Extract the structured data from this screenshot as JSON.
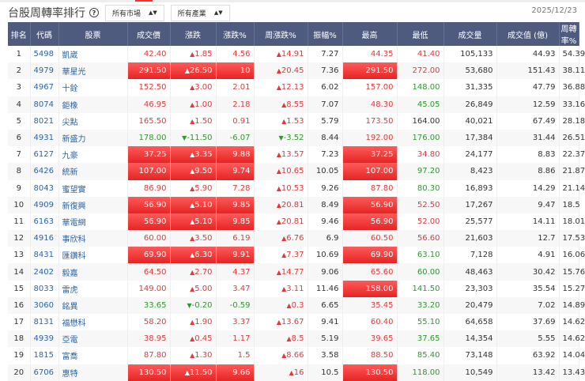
{
  "title": "台股周轉率排行",
  "help_icon": "?",
  "filters": {
    "market": "所有市場",
    "industry": "所有產業"
  },
  "date": "2025/12/23",
  "colors": {
    "up": "#e03a3a",
    "down": "#2a9a2a",
    "header": "#4e5b7e",
    "limit": "#f03030"
  },
  "columns": [
    "排名",
    "代碼",
    "股票",
    "成交價",
    "漲跌",
    "漲跌%",
    "周漲跌%",
    "振幅%",
    "最高",
    "最低",
    "成交量",
    "成交值 (億)",
    "周轉率%"
  ],
  "rows": [
    {
      "rank": "1",
      "code": "5498",
      "name": "凱崴",
      "price": "42.40",
      "chg": "1.85",
      "pct": "4.56",
      "wk": "14.91",
      "amp": "7.27",
      "high": "44.35",
      "low": "41.40",
      "vol": "105,133",
      "val": "44.93",
      "turn": "54.39",
      "limit": []
    },
    {
      "rank": "2",
      "code": "4979",
      "name": "華星光",
      "price": "291.50",
      "chg": "26.50",
      "pct": "10",
      "wk": "20.45",
      "amp": "7.36",
      "high": "291.50",
      "low": "272.00",
      "vol": "53,680",
      "val": "151.43",
      "turn": "38.11",
      "limit": [
        "price",
        "chg",
        "pct",
        "high"
      ]
    },
    {
      "rank": "3",
      "code": "4967",
      "name": "十銓",
      "price": "152.50",
      "chg": "3.00",
      "pct": "2.01",
      "wk": "12.13",
      "amp": "6.02",
      "high": "157.00",
      "low": "148.00",
      "vol": "31,335",
      "val": "47.79",
      "turn": "36.88",
      "limit": []
    },
    {
      "rank": "4",
      "code": "8074",
      "name": "鉅橡",
      "price": "46.95",
      "chg": "1.00",
      "pct": "2.18",
      "wk": "8.55",
      "amp": "7.07",
      "high": "48.30",
      "low": "45.05",
      "vol": "26,849",
      "val": "12.59",
      "turn": "33.16",
      "limit": []
    },
    {
      "rank": "5",
      "code": "8021",
      "name": "尖點",
      "price": "165.50",
      "chg": "1.50",
      "pct": "0.91",
      "wk": "1.53",
      "amp": "5.79",
      "high": "173.50",
      "low": "164.00",
      "vol": "40,021",
      "val": "67.49",
      "turn": "28.18",
      "limit": []
    },
    {
      "rank": "6",
      "code": "4931",
      "name": "新盛力",
      "price": "178.00",
      "chg": "-11.50",
      "pct": "-6.07",
      "wk": "-3.52",
      "amp": "8.44",
      "high": "192.00",
      "low": "176.00",
      "vol": "17,384",
      "val": "31.44",
      "turn": "26.51",
      "limit": []
    },
    {
      "rank": "7",
      "code": "6127",
      "name": "九豪",
      "price": "37.25",
      "chg": "3.35",
      "pct": "9.88",
      "wk": "13.57",
      "amp": "7.23",
      "high": "37.25",
      "low": "34.80",
      "vol": "24,177",
      "val": "8.83",
      "turn": "22.37",
      "limit": [
        "price",
        "chg",
        "pct",
        "high"
      ]
    },
    {
      "rank": "8",
      "code": "6426",
      "name": "統新",
      "price": "107.00",
      "chg": "9.50",
      "pct": "9.74",
      "wk": "10.65",
      "amp": "10.05",
      "high": "107.00",
      "low": "97.20",
      "vol": "8,423",
      "val": "8.86",
      "turn": "21.87",
      "limit": [
        "price",
        "chg",
        "pct",
        "high"
      ]
    },
    {
      "rank": "9",
      "code": "8043",
      "name": "蜜望實",
      "price": "86.90",
      "chg": "5.90",
      "pct": "7.28",
      "wk": "10.53",
      "amp": "9.26",
      "high": "87.80",
      "low": "80.30",
      "vol": "16,893",
      "val": "14.29",
      "turn": "21.14",
      "limit": []
    },
    {
      "rank": "10",
      "code": "4909",
      "name": "新復興",
      "price": "56.90",
      "chg": "5.10",
      "pct": "9.85",
      "wk": "20.81",
      "amp": "8.49",
      "high": "56.90",
      "low": "52.50",
      "vol": "17,267",
      "val": "9.47",
      "turn": "18.5",
      "limit": [
        "price",
        "chg",
        "pct",
        "high"
      ]
    },
    {
      "rank": "11",
      "code": "6163",
      "name": "華電網",
      "price": "56.90",
      "chg": "5.10",
      "pct": "9.85",
      "wk": "20.81",
      "amp": "9.46",
      "high": "56.90",
      "low": "52.00",
      "vol": "25,577",
      "val": "14.11",
      "turn": "18.01",
      "limit": [
        "price",
        "chg",
        "pct",
        "high"
      ]
    },
    {
      "rank": "12",
      "code": "4916",
      "name": "事欣科",
      "price": "60.00",
      "chg": "3.50",
      "pct": "6.19",
      "wk": "6.76",
      "amp": "6.9",
      "high": "60.50",
      "low": "56.60",
      "vol": "21,603",
      "val": "12.7",
      "turn": "17.53",
      "limit": []
    },
    {
      "rank": "13",
      "code": "8431",
      "name": "匯鑽科",
      "price": "69.90",
      "chg": "6.30",
      "pct": "9.91",
      "wk": "7.37",
      "amp": "10.69",
      "high": "69.90",
      "low": "63.10",
      "vol": "7,128",
      "val": "4.91",
      "turn": "16.06",
      "limit": [
        "price",
        "chg",
        "pct",
        "high"
      ]
    },
    {
      "rank": "14",
      "code": "2402",
      "name": "毅嘉",
      "price": "64.50",
      "chg": "2.70",
      "pct": "4.37",
      "wk": "14.77",
      "amp": "9.06",
      "high": "65.60",
      "low": "60.00",
      "vol": "48,463",
      "val": "30.42",
      "turn": "15.76",
      "limit": []
    },
    {
      "rank": "15",
      "code": "8033",
      "name": "雷虎",
      "price": "149.00",
      "chg": "5.00",
      "pct": "3.47",
      "wk": "3.11",
      "amp": "11.46",
      "high": "158.00",
      "low": "141.50",
      "vol": "23,303",
      "val": "35.54",
      "turn": "15.27",
      "limit": [
        "high"
      ]
    },
    {
      "rank": "16",
      "code": "3060",
      "name": "銘異",
      "price": "33.65",
      "chg": "-0.20",
      "pct": "-0.59",
      "wk": "0.3",
      "amp": "6.65",
      "high": "35.45",
      "low": "33.20",
      "vol": "20,479",
      "val": "7.02",
      "turn": "14.89",
      "limit": []
    },
    {
      "rank": "17",
      "code": "8131",
      "name": "福懋科",
      "price": "58.20",
      "chg": "1.90",
      "pct": "3.37",
      "wk": "13.67",
      "amp": "9.41",
      "high": "60.40",
      "low": "55.10",
      "vol": "64,658",
      "val": "37.69",
      "turn": "14.62",
      "limit": []
    },
    {
      "rank": "18",
      "code": "4939",
      "name": "亞電",
      "price": "38.95",
      "chg": "0.45",
      "pct": "1.17",
      "wk": "8.5",
      "amp": "5.19",
      "high": "39.65",
      "low": "37.65",
      "vol": "14,354",
      "val": "5.55",
      "turn": "14.62",
      "limit": []
    },
    {
      "rank": "19",
      "code": "1815",
      "name": "富喬",
      "price": "87.80",
      "chg": "1.30",
      "pct": "1.5",
      "wk": "8.66",
      "amp": "3.58",
      "high": "88.50",
      "low": "85.40",
      "vol": "73,148",
      "val": "63.92",
      "turn": "14.04",
      "limit": []
    },
    {
      "rank": "20",
      "code": "6706",
      "name": "惠特",
      "price": "130.50",
      "chg": "11.50",
      "pct": "9.66",
      "wk": "16",
      "amp": "10.5",
      "high": "130.50",
      "low": "118.00",
      "vol": "10,549",
      "val": "13.42",
      "turn": "13.43",
      "limit": [
        "price",
        "chg",
        "pct",
        "high"
      ]
    }
  ]
}
